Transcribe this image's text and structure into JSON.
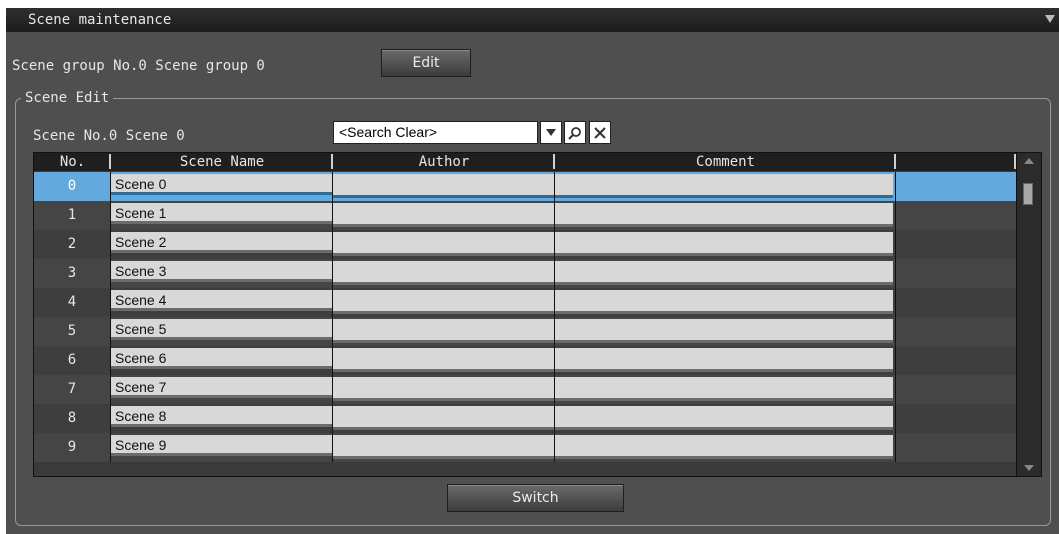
{
  "window": {
    "title": "Scene maintenance"
  },
  "scene_group": {
    "text": "Scene group No.0 Scene group 0",
    "edit_label": "Edit"
  },
  "scene_edit": {
    "legend": "Scene Edit",
    "current_scene": "Scene No.0 Scene 0",
    "search": {
      "value": "<Search Clear>"
    }
  },
  "table": {
    "headers": {
      "no": "No.",
      "name": "Scene Name",
      "author": "Author",
      "comment": "Comment"
    },
    "rows": [
      {
        "no": "0",
        "name": "Scene 0"
      },
      {
        "no": "1",
        "name": "Scene 1"
      },
      {
        "no": "2",
        "name": "Scene 2"
      },
      {
        "no": "3",
        "name": "Scene 3"
      },
      {
        "no": "4",
        "name": "Scene 4"
      },
      {
        "no": "5",
        "name": "Scene 5"
      },
      {
        "no": "6",
        "name": "Scene 6"
      },
      {
        "no": "7",
        "name": "Scene 7"
      },
      {
        "no": "8",
        "name": "Scene 8"
      },
      {
        "no": "9",
        "name": "Scene 9"
      }
    ],
    "selected_index": 0
  },
  "actions": {
    "switch_label": "Switch"
  },
  "colors": {
    "selection": "#63a9dd",
    "panel": "#4f4f4f",
    "titlebar": "#1c1c1c"
  },
  "icons": [
    "dropdown-arrow-icon",
    "search-icon",
    "clear-icon",
    "collapse-arrow-icon"
  ]
}
